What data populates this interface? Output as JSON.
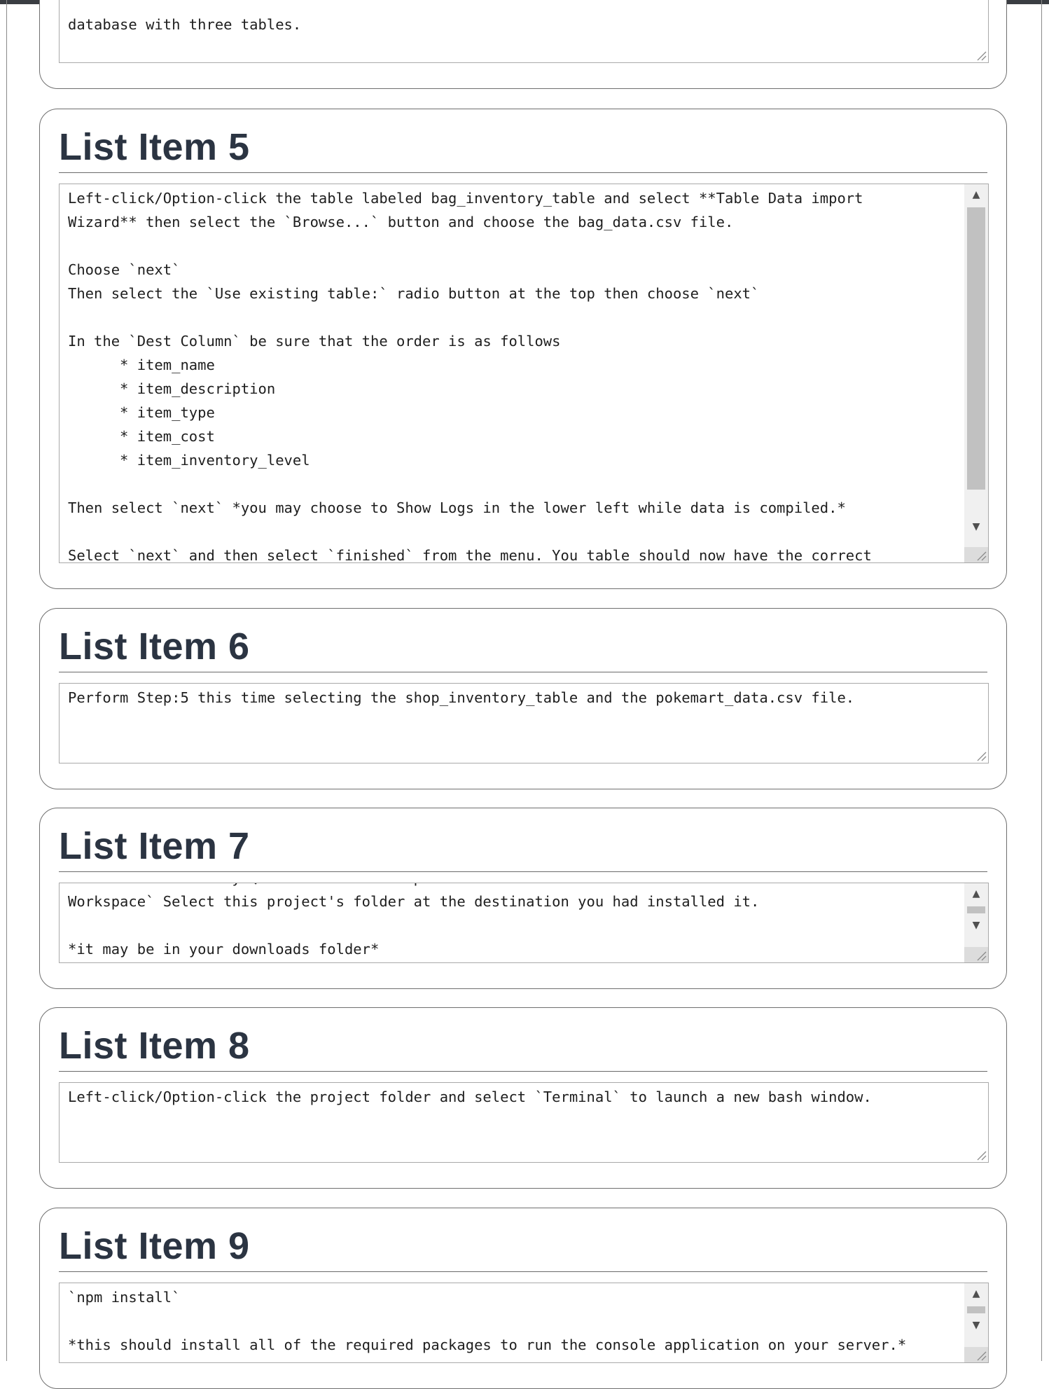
{
  "items": [
    {
      "title": "",
      "text": "database with three tables."
    },
    {
      "title": "List Item 5",
      "text": "Left-click/Option-click the table labeled bag_inventory_table and select **Table Data import\nWizard** then select the `Browse...` button and choose the bag_data.csv file.\n\nChoose `next`\nThen select the `Use existing table:` radio button at the top then choose `next`\n\nIn the `Dest Column` be sure that the order is as follows\n      * item_name\n      * item_description\n      * item_type\n      * item_cost\n      * item_inventory_level\n\nThen select `next` *you may choose to Show Logs in the lower left while data is compiled.*\n\nSelect `next` and then select `finished` from the menu. You table should now have the correct"
    },
    {
      "title": "List Item 6",
      "text": "Perform Step:5 this time selecting the shop_inventory_table and the pokemart_data.csv file."
    },
    {
      "title": "List Item 7",
      "text": "You are done with mySQL workbench. Now open `VS Code` and use the `File` menu to `Add Folder to\nWorkspace` Select this project's folder at the destination you had installed it.\n\n*it may be in your downloads folder*"
    },
    {
      "title": "List Item 8",
      "text": "Left-click/Option-click the project folder and select `Terminal` to launch a new bash window."
    },
    {
      "title": "List Item 9",
      "text": "`npm install`\n\n*this should install all of the required packages to run the console application on your server.*"
    }
  ],
  "scrollbar": {
    "up_arrow": "▲",
    "down_arrow": "▼"
  }
}
